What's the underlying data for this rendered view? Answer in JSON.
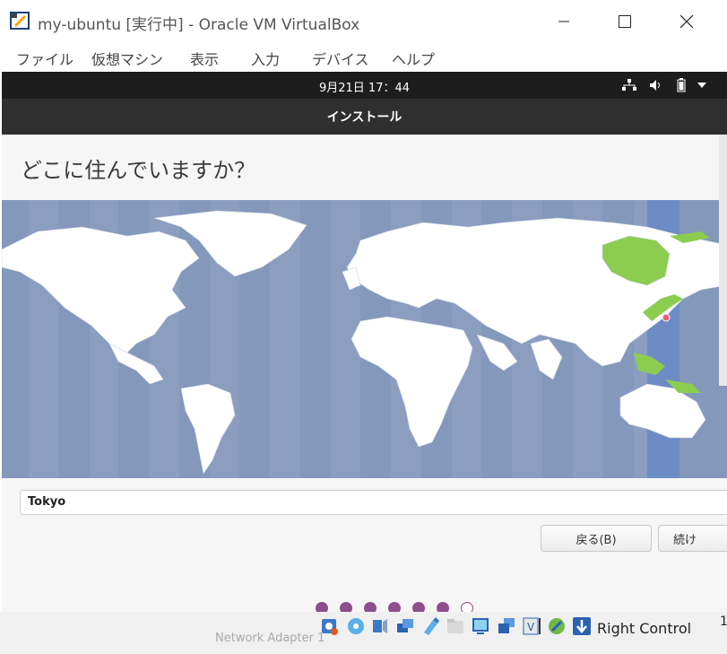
{
  "window": {
    "title": "my-ubuntu [実行中] - Oracle VM VirtualBox",
    "minimize_label": "—",
    "maximize_label": "☐",
    "close_label": "✕"
  },
  "menu": {
    "items": [
      "ファイル",
      "仮想マシン",
      "表示",
      "入力",
      "デバイス",
      "ヘルプ"
    ]
  },
  "guest": {
    "clock": "9月21日 17：44",
    "tray_icons": [
      "network-icon",
      "volume-icon",
      "battery-icon",
      "system-menu-icon"
    ],
    "header_title": "インストール",
    "question": "どこに住んでいますか？",
    "timezone_value": "Tokyo",
    "back_button": "戻る(B)",
    "continue_button": "続け",
    "progress": {
      "total_steps": 7,
      "completed_steps": 6
    }
  },
  "statusbar": {
    "host_key": "Right Control",
    "bottom_text": "Network Adapter 1",
    "edge_char": "1"
  },
  "colors": {
    "ocean": "#8b9ec0",
    "land": "#ffffff",
    "selected_zone": "#6d8cc6",
    "highlight_land": "#8ccd50",
    "marker": "#e0607a",
    "progress_dot": "#8e4e8e"
  }
}
